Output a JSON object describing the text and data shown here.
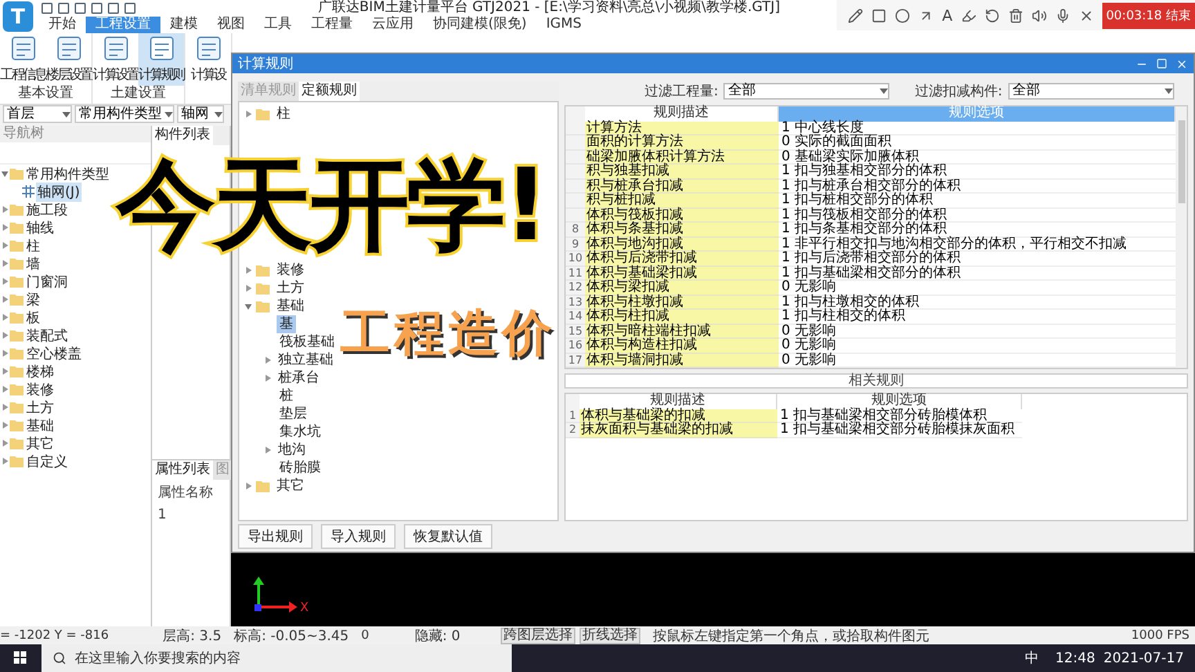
{
  "app": {
    "logo": "T",
    "title": "广联达BIM土建计量平台 GTJ2021 - [E:\\学习资料\\亮总\\小视频\\教学楼.GTJ]",
    "menu": [
      {
        "label": "开始",
        "selected": false
      },
      {
        "label": "工程设置",
        "selected": true
      },
      {
        "label": "建模",
        "selected": false
      },
      {
        "label": "视图",
        "selected": false
      },
      {
        "label": "工具",
        "selected": false
      },
      {
        "label": "工程量",
        "selected": false
      },
      {
        "label": "云应用",
        "selected": false
      },
      {
        "label": "协同建模(限免)",
        "selected": false
      },
      {
        "label": "IGMS",
        "selected": false
      }
    ]
  },
  "recorder": {
    "letter_tool": "A",
    "timer": "00:03:18 结束"
  },
  "ribbon": {
    "groups": [
      {
        "label": "基本设置",
        "buttons": [
          {
            "label": "工程信息",
            "selected": false
          },
          {
            "label": "楼层设置",
            "selected": false
          }
        ]
      },
      {
        "label": "土建设置",
        "buttons": [
          {
            "label": "计算设置",
            "selected": false
          },
          {
            "label": "计算规则",
            "selected": true
          }
        ]
      },
      {
        "buttons": [
          {
            "label": "计算设",
            "selected": false
          }
        ]
      }
    ]
  },
  "selectors": [
    "首层",
    "常用构件类型",
    "轴网"
  ],
  "nav": {
    "title": "导航树",
    "items": [
      {
        "label": "常用构件类型",
        "expanded": true,
        "children": [
          {
            "label": "轴网(J)",
            "selected": true
          }
        ]
      },
      {
        "label": "施工段",
        "expanded": false
      },
      {
        "label": "轴线",
        "expanded": false
      },
      {
        "label": "柱",
        "expanded": false
      },
      {
        "label": "墙",
        "expanded": false
      },
      {
        "label": "门窗洞",
        "expanded": false
      },
      {
        "label": "梁",
        "expanded": false
      },
      {
        "label": "板",
        "expanded": false
      },
      {
        "label": "装配式",
        "expanded": false
      },
      {
        "label": "空心楼盖",
        "expanded": false
      },
      {
        "label": "楼梯",
        "expanded": false
      },
      {
        "label": "装修",
        "expanded": false
      },
      {
        "label": "土方",
        "expanded": false
      },
      {
        "label": "基础",
        "expanded": false
      },
      {
        "label": "其它",
        "expanded": false
      },
      {
        "label": "自定义",
        "expanded": false
      }
    ]
  },
  "component_panel": {
    "tabs": [
      {
        "label": "构件列表",
        "selected": true
      }
    ],
    "property_tabs": [
      {
        "label": "属性列表",
        "selected": true
      },
      {
        "label": "图",
        "selected": false
      }
    ],
    "column": "属性名称",
    "row_no": "1"
  },
  "dialog": {
    "title": "计算规则",
    "tabs": [
      {
        "label": "清单规则",
        "selected": false
      },
      {
        "label": "定额规则",
        "selected": true
      }
    ],
    "tree": [
      {
        "label": "柱",
        "kind": "folder",
        "expanded": false
      },
      {
        "label": "装修",
        "kind": "folder",
        "expanded": false
      },
      {
        "label": "土方",
        "kind": "folder",
        "expanded": false
      },
      {
        "label": "基础",
        "kind": "folder",
        "expanded": true,
        "children": [
          {
            "label": "基",
            "kind": "leaf",
            "selected": true
          },
          {
            "label": "筏板基础",
            "kind": "leaf",
            "selected": false
          },
          {
            "label": "独立基础",
            "kind": "group",
            "selected": false
          },
          {
            "label": "桩承台",
            "kind": "group",
            "selected": false
          },
          {
            "label": "桩",
            "kind": "leaf",
            "selected": false
          },
          {
            "label": "垫层",
            "kind": "leaf",
            "selected": false
          },
          {
            "label": "集水坑",
            "kind": "leaf",
            "selected": false
          },
          {
            "label": "地沟",
            "kind": "group",
            "selected": false
          },
          {
            "label": "砖胎膜",
            "kind": "leaf",
            "selected": false
          }
        ]
      },
      {
        "label": "其它",
        "kind": "folder",
        "expanded": false
      }
    ],
    "buttons": [
      "导出规则",
      "导入规则",
      "恢复默认值"
    ],
    "filters": [
      {
        "label": "过滤工程量:",
        "value": "全部"
      },
      {
        "label": "过滤扣减构件:",
        "value": "全部"
      }
    ],
    "columns": [
      {
        "label": "规则描述",
        "selected": false
      },
      {
        "label": "规则选项",
        "selected": true
      }
    ],
    "rows": [
      {
        "desc": "计算方法",
        "option": "1 中心线长度"
      },
      {
        "desc": "面积的计算方法",
        "option": "0 实际的截面面积"
      },
      {
        "desc": "础梁加腋体积计算方法",
        "option": "0 基础梁实际加腋体积"
      },
      {
        "desc": "积与独基扣减",
        "option": "1 扣与独基相交部分的体积"
      },
      {
        "desc": "积与桩承台扣减",
        "option": "1 扣与桩承台相交部分的体积"
      },
      {
        "desc": "积与桩扣减",
        "option": "1 扣与桩相交部分的体积"
      },
      {
        "desc": "体积与筏板扣减",
        "option": "1 扣与筏板相交部分的体积"
      },
      {
        "no": "8",
        "desc": "体积与条基扣减",
        "option": "1 扣与条基相交部分的体积"
      },
      {
        "no": "9",
        "desc": "体积与地沟扣减",
        "option": "1 非平行相交扣与地沟相交部分的体积，平行相交不扣减"
      },
      {
        "no": "10",
        "desc": "体积与后浇带扣减",
        "option": "1 扣与后浇带相交部分的体积"
      },
      {
        "no": "11",
        "desc": "体积与基础梁扣减",
        "option": "1 扣与基础梁相交部分的体积"
      },
      {
        "no": "12",
        "desc": "体积与梁扣减",
        "option": "0   无影响"
      },
      {
        "no": "13",
        "desc": "体积与柱墩扣减",
        "option": "1 扣与柱墩相交的体积"
      },
      {
        "no": "14",
        "desc": "体积与柱扣减",
        "option": "1 扣与柱相交的体积"
      },
      {
        "no": "15",
        "desc": "体积与暗柱端柱扣减",
        "option": "0   无影响"
      },
      {
        "no": "16",
        "desc": "体积与构造柱扣减",
        "option": "0   无影响"
      },
      {
        "no": "17",
        "desc": "体积与墙洞扣减",
        "option": "0   无影响"
      }
    ],
    "related_title": "相关规则",
    "related_columns": [
      "规则描述",
      "规则选项"
    ],
    "related_rows": [
      {
        "no": "1",
        "desc": "体积与基础梁的扣减",
        "option": "1 扣与基础梁相交部分砖胎模体积"
      },
      {
        "no": "2",
        "desc": "抹灰面积与基础梁的扣减",
        "option": "1 扣与基础梁相交部分砖胎模抹灰面积"
      }
    ]
  },
  "canvas": {
    "axis_label": "X"
  },
  "status": {
    "coords": "= -1202 Y = -816",
    "floor_height": "层高:  3.5",
    "elevation": "标高:  -0.05~3.45",
    "value": "0",
    "hidden": "隐藏:  0",
    "tools": [
      "跨图层选择",
      "折线选择"
    ],
    "hint": "按鼠标左键指定第一个角点，或拾取构件图元",
    "fps": "1000 FPS"
  },
  "taskbar": {
    "search": "在这里输入你要搜索的内容",
    "ime": "中",
    "time": "12:48",
    "date": "2021-07-17"
  },
  "overlay": {
    "headline": "今天开学!",
    "subtitle": "工程造价"
  }
}
